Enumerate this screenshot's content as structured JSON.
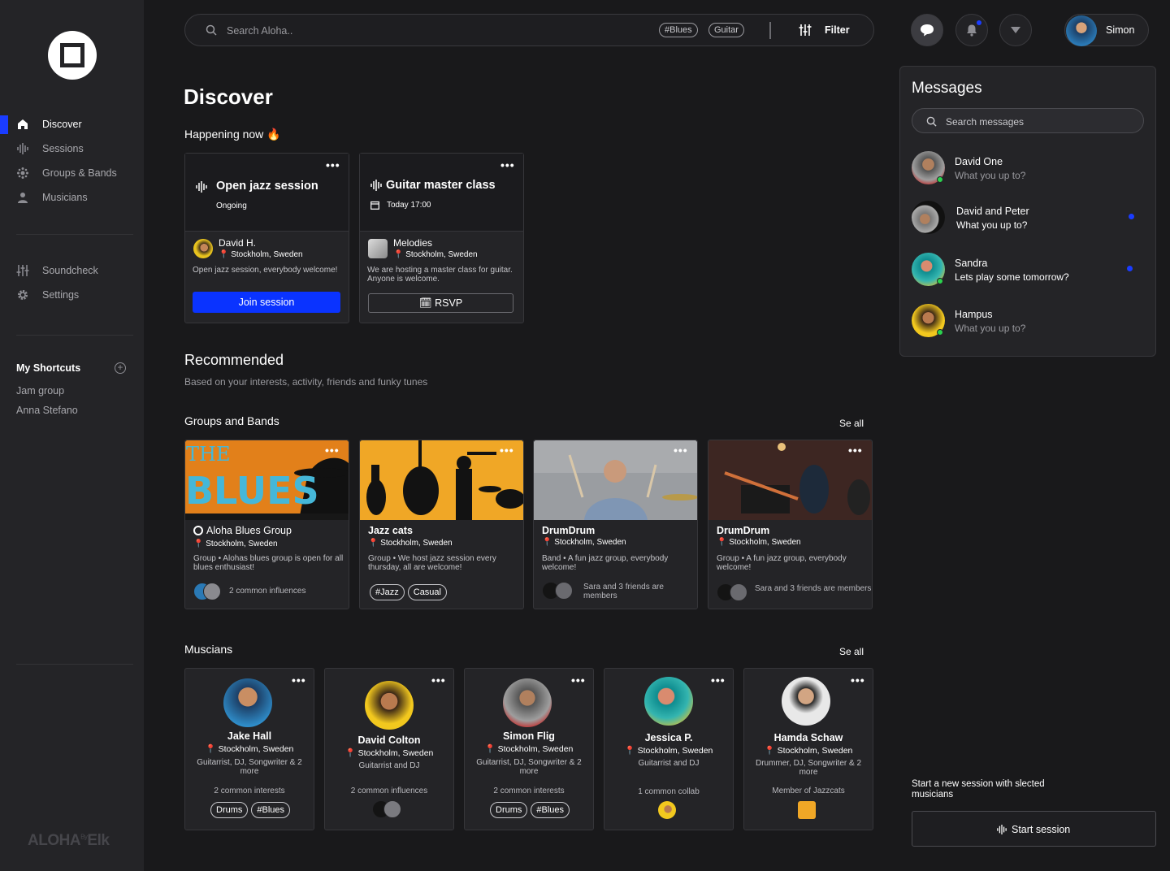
{
  "nav": {
    "items": [
      {
        "label": "Discover",
        "icon": "home-icon"
      },
      {
        "label": "Sessions",
        "icon": "waveform-icon"
      },
      {
        "label": "Groups & Bands",
        "icon": "groups-icon"
      },
      {
        "label": "Musicians",
        "icon": "person-icon"
      }
    ],
    "tools": [
      {
        "label": "Soundcheck",
        "icon": "sliders-icon"
      },
      {
        "label": "Settings",
        "icon": "gear-icon"
      }
    ],
    "shortcuts_title": "My Shortcuts",
    "shortcuts": [
      "Jam group",
      "Anna Stefano"
    ],
    "brand": "ALOHA",
    "brand_by": "By",
    "brand_suffix": "Elk"
  },
  "search": {
    "placeholder": "Search Aloha..",
    "chips": [
      "#Blues",
      "Guitar"
    ],
    "filter_label": "Filter"
  },
  "user": {
    "name": "Simon"
  },
  "colors": {
    "accent": "#0a33ff",
    "background": "#19191b",
    "panel": "#242427",
    "online": "#2bd34e"
  },
  "main": {
    "title": "Discover",
    "happening_title": "Happening now 🔥",
    "events": [
      {
        "title": "Open jazz session",
        "status": "Ongoing",
        "host": "David H.",
        "location": "Stockholm, Sweden",
        "desc": "Open jazz session, everybody welcome!",
        "action": "Join session"
      },
      {
        "title": "Guitar master class",
        "status": "Today 17:00",
        "host": "Melodies",
        "location": "Stockholm, Sweden",
        "desc": "We are hosting a master class for guitar. Anyone is welcome.",
        "action": "RSVP"
      }
    ],
    "recommended_title": "Recommended",
    "recommended_sub": "Based on your interests, activity, friends and funky tunes",
    "groups_title": "Groups and Bands",
    "groups_see_all": "Se all",
    "groups": [
      {
        "title": "Aloha Blues Group",
        "location": "Stockholm, Sweden",
        "desc": "Group • Alohas blues group is open for all blues enthusiast!",
        "foot": "2 common influences",
        "tags": []
      },
      {
        "title": "Jazz cats",
        "location": "Stockholm, Sweden",
        "desc": "Group • We host jazz session every thursday, all are welcome!",
        "foot": "",
        "tags": [
          "#Jazz",
          "Casual"
        ]
      },
      {
        "title": "DrumDrum",
        "location": "Stockholm, Sweden",
        "desc": "Band • A fun jazz group, everybody welcome!",
        "foot": "Sara and 3 friends are members",
        "tags": []
      },
      {
        "title": "DrumDrum",
        "location": "Stockholm, Sweden",
        "desc": "Group • A fun jazz group, everybody welcome!",
        "foot": "Sara and 3 friends are members",
        "tags": []
      }
    ],
    "blues_image_text": [
      "THE",
      "BLUES"
    ],
    "musicians_title": "Muscians",
    "musicians_see_all": "Se all",
    "musicians": [
      {
        "name": "Jake Hall",
        "location": "Stockholm, Sweden",
        "role": "Guitarrist, DJ, Songwriter & 2 more",
        "common": "2 common interests",
        "tags": [
          "Drums",
          "#Blues"
        ]
      },
      {
        "name": "David Colton",
        "location": "Stockholm, Sweden",
        "role": "Guitarrist and DJ",
        "common": "2 common influences",
        "tags": []
      },
      {
        "name": "Simon Flig",
        "location": "Stockholm, Sweden",
        "role": "Guitarrist, DJ, Songwriter & 2 more",
        "common": "2 common interests",
        "tags": [
          "Drums",
          "#Blues"
        ]
      },
      {
        "name": "Jessica P.",
        "location": "Stockholm, Sweden",
        "role": "Guitarrist and DJ",
        "common": "1 common collab",
        "tags": []
      },
      {
        "name": "Hamda Schaw",
        "location": "Stockholm, Sweden",
        "role": "Drummer, DJ, Songwriter & 2 more",
        "common": "Member of Jazzcats",
        "tags": []
      }
    ]
  },
  "messages": {
    "title": "Messages",
    "search_placeholder": "Search messages",
    "items": [
      {
        "name": "David One",
        "text": "What you up to?",
        "unread": false,
        "online": true
      },
      {
        "name": "David and Peter",
        "text": "What you up to?",
        "unread": true,
        "online": false
      },
      {
        "name": "Sandra",
        "text": "Lets play some tomorrow?",
        "unread": true,
        "online": true
      },
      {
        "name": "Hampus",
        "text": "What you up to?",
        "unread": false,
        "online": true
      }
    ],
    "start_text": "Start a new session with slected musicians",
    "start_button": "Start session"
  }
}
